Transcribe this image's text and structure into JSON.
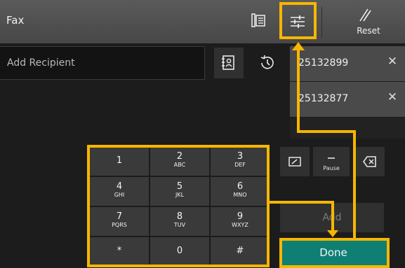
{
  "header": {
    "title": "Fax",
    "reset_label": "Reset"
  },
  "recipient": {
    "placeholder": "Add Recipient"
  },
  "recipients": [
    {
      "number": "25132899"
    },
    {
      "number": "25132877"
    }
  ],
  "keypad": {
    "keys": [
      {
        "digit": "1",
        "letters": ""
      },
      {
        "digit": "2",
        "letters": "ABC"
      },
      {
        "digit": "3",
        "letters": "DEF"
      },
      {
        "digit": "4",
        "letters": "GHI"
      },
      {
        "digit": "5",
        "letters": "JKL"
      },
      {
        "digit": "6",
        "letters": "MNO"
      },
      {
        "digit": "7",
        "letters": "PQRS"
      },
      {
        "digit": "8",
        "letters": "TUV"
      },
      {
        "digit": "9",
        "letters": "WXYZ"
      },
      {
        "digit": "*",
        "letters": ""
      },
      {
        "digit": "0",
        "letters": ""
      },
      {
        "digit": "#",
        "letters": ""
      }
    ]
  },
  "tools": {
    "pause_label": "Pause"
  },
  "actions": {
    "add_label": "Add",
    "done_label": "Done"
  },
  "colors": {
    "highlight": "#f6b600",
    "done": "#0f7f74"
  },
  "icons": [
    "wall-icon",
    "settings-sliders-icon",
    "reset-slash-icon",
    "address-book-icon",
    "history-icon",
    "close-icon",
    "edit-icon",
    "pause-icon",
    "backspace-icon"
  ]
}
